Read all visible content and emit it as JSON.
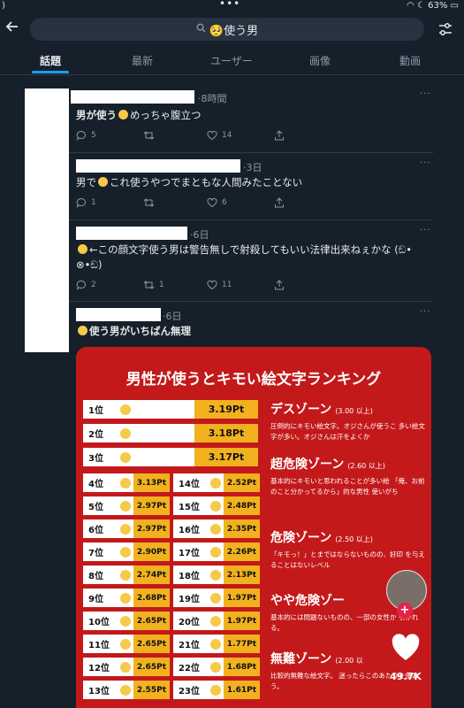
{
  "status": {
    "left": ")",
    "battery": "63%"
  },
  "search": {
    "query": "🥺使う男"
  },
  "tabs": [
    "話題",
    "最新",
    "ユーザー",
    "画像",
    "動画"
  ],
  "tweets": [
    {
      "time": "·8時間",
      "text_a": "男が使う",
      "text_b": "めっちゃ腹立つ",
      "replies": "5",
      "retweets": "",
      "likes": "14"
    },
    {
      "time": "·3日",
      "text_a": "男で",
      "text_b": "これ使うやつでまともな人間みたことない",
      "replies": "1",
      "retweets": "",
      "likes": "6"
    },
    {
      "time": "·6日",
      "text_b": "←この顔文字使う男は警告無しで射殺してもいい法律出来ねぇかな (ඞ•",
      "text_c": "⊗•ඞ)",
      "replies": "2",
      "retweets": "1",
      "likes": "11"
    },
    {
      "time": "·6日",
      "text_b": "使う男がいちばん無理"
    }
  ],
  "image": {
    "title": "男性が使うとキモい絵文字ランキング",
    "top": [
      {
        "pos": "1位",
        "pt": "3.19Pt"
      },
      {
        "pos": "2位",
        "pt": "3.18Pt"
      },
      {
        "pos": "3位",
        "pt": "3.17Pt"
      }
    ],
    "left": [
      {
        "pos": "4位",
        "pt": "3.13Pt"
      },
      {
        "pos": "5位",
        "pt": "2.97Pt"
      },
      {
        "pos": "6位",
        "pt": "2.97Pt"
      },
      {
        "pos": "7位",
        "pt": "2.90Pt"
      },
      {
        "pos": "8位",
        "pt": "2.74Pt"
      },
      {
        "pos": "9位",
        "pt": "2.68Pt"
      },
      {
        "pos": "10位",
        "pt": "2.65Pt"
      },
      {
        "pos": "11位",
        "pt": "2.65Pt"
      },
      {
        "pos": "12位",
        "pt": "2.65Pt"
      },
      {
        "pos": "13位",
        "pt": "2.55Pt"
      }
    ],
    "right": [
      {
        "pos": "14位",
        "pt": "2.52Pt"
      },
      {
        "pos": "15位",
        "pt": "2.48Pt"
      },
      {
        "pos": "16位",
        "pt": "2.35Pt"
      },
      {
        "pos": "17位",
        "pt": "2.26Pt"
      },
      {
        "pos": "18位",
        "pt": "2.13Pt"
      },
      {
        "pos": "19位",
        "pt": "1.97Pt"
      },
      {
        "pos": "20位",
        "pt": "1.97Pt"
      },
      {
        "pos": "21位",
        "pt": "1.77Pt"
      },
      {
        "pos": "22位",
        "pt": "1.68Pt"
      },
      {
        "pos": "23位",
        "pt": "1.61Pt"
      }
    ],
    "zones": [
      {
        "name": "デスゾーン",
        "range": "(3.00 以上)",
        "desc": "圧倒的にキモい絵文字。オジさんが使うこ 多い絵文字が多い。オジさんは汗をよくか"
      },
      {
        "name": "超危険ゾーン",
        "range": "(2.60 以上)",
        "desc": "基本的にキモいと思われることが多い絵 「俺、お前のこと分かってるから」的な男性 使いがち"
      },
      {
        "name": "危険ゾーン",
        "range": "(2.50 以上)",
        "desc": "「キモっ！」とまではならないものの、好印 を与えることはないレベル"
      },
      {
        "name": "やや危険ゾー",
        "range": "",
        "desc": "基本的には問題ないものの、一部の女性か 引かれる。"
      },
      {
        "name": "無難ゾーン",
        "range": "(2.00 以",
        "desc": "比較的無難な絵文字。 迷ったらこのあたりを使おう。"
      }
    ],
    "like_count": "49.7K"
  }
}
